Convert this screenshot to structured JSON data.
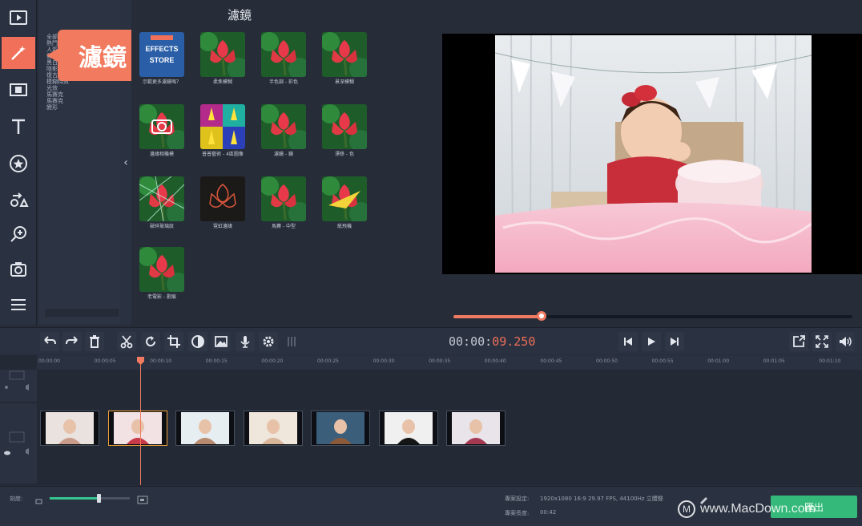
{
  "callout": {
    "text": "濾鏡"
  },
  "panel": {
    "title": "濾鏡"
  },
  "categories": [
    "全部",
    "熱門",
    "人氣",
    "藝術",
    "黑白",
    "陰影",
    "復古濾鏡",
    "模糊特效",
    "光效",
    "馬賽克",
    "馬賽克",
    "變形"
  ],
  "filters": [
    {
      "label": "示範更多濾鏡嗎？",
      "style": "store",
      "store_text": [
        "EFFECTS",
        "STORE"
      ]
    },
    {
      "label": "柔焦模糊",
      "style": "red"
    },
    {
      "label": "半色調 - 彩色",
      "style": "red"
    },
    {
      "label": "景深模糊",
      "style": "red"
    },
    {
      "label": "邊緣相機模",
      "style": "camera"
    },
    {
      "label": "普普藝術 - 4區圖像",
      "style": "pop"
    },
    {
      "label": "濾鏡 - 鏡",
      "style": "red"
    },
    {
      "label": "漂移 - 色",
      "style": "red"
    },
    {
      "label": "破碎玻璃紋",
      "style": "glass"
    },
    {
      "label": "霓虹邊緣",
      "style": "neon"
    },
    {
      "label": "馬賽 - 中型",
      "style": "red"
    },
    {
      "label": "紙飛機",
      "style": "plane"
    },
    {
      "label": "老電影 - 劃痕",
      "style": "red"
    }
  ],
  "player": {
    "timecode_main": "00:00:",
    "timecode_ms": "09.250",
    "progress": 0.22
  },
  "timeline": {
    "ticks": [
      "00:00:00",
      "00:00:05",
      "00:00:10",
      "00:00:15",
      "00:00:20",
      "00:00:25",
      "00:00:30",
      "00:00:35",
      "00:00:40",
      "00:00:45",
      "00:00:50",
      "00:00:55",
      "00:01:00",
      "00:01:05",
      "00:01:10"
    ],
    "clip_count": 7
  },
  "status": {
    "zoom_label": "刻度:",
    "settings_label": "專案設定:",
    "settings_value": "1920x1080 16:9 29.97 FPS, 44100Hz 立體聲",
    "length_label": "專案長度:",
    "length_value": "00:42",
    "export_label": "匯出"
  },
  "watermark": {
    "text": "www.MacDown.com",
    "logo": "M"
  },
  "colors": {
    "accent": "#f0705a",
    "export": "#35b97a",
    "panel": "#262c38"
  }
}
